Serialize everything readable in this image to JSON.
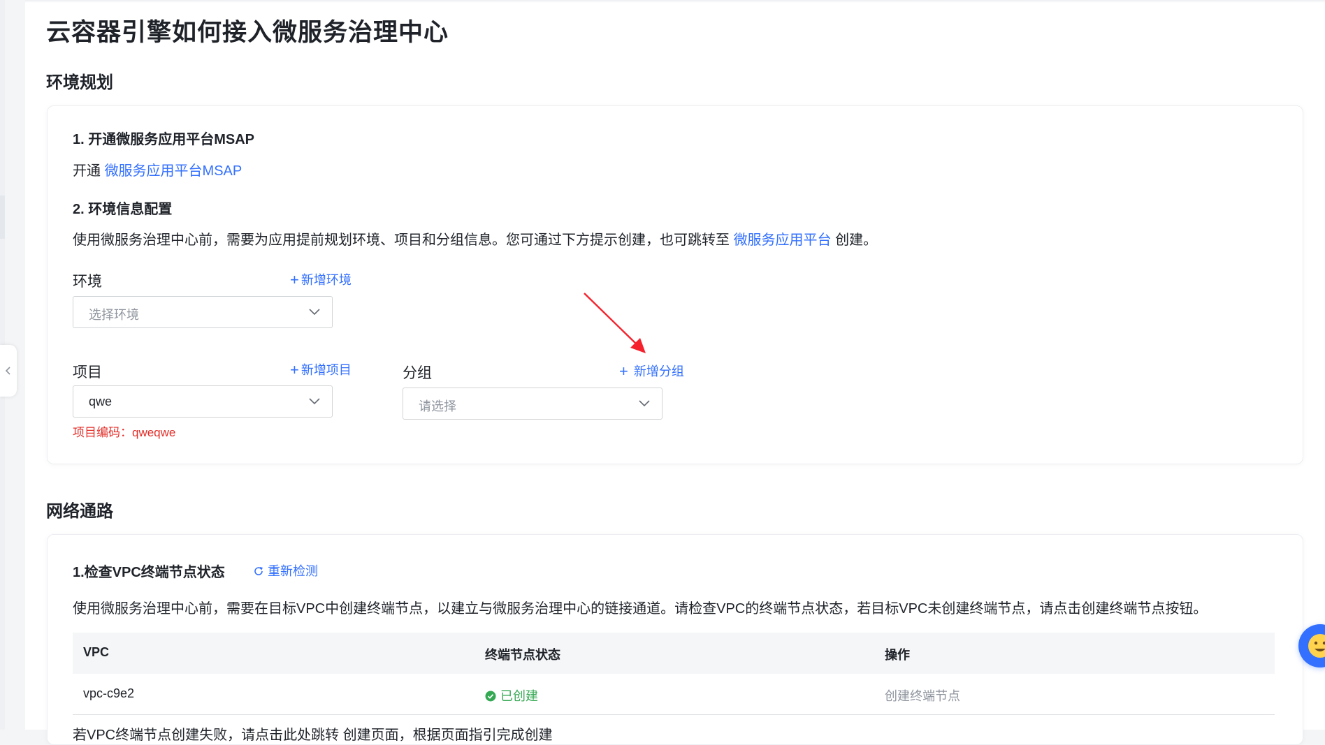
{
  "page": {
    "title": "云容器引擎如何接入微服务治理中心"
  },
  "env_section": {
    "title": "环境规划",
    "step1": {
      "title": "1. 开通微服务应用平台MSAP",
      "prefix": "开通 ",
      "link": "微服务应用平台MSAP"
    },
    "step2": {
      "title": "2. 环境信息配置",
      "desc_prefix": "使用微服务治理中心前，需要为应用提前规划环境、项目和分组信息。您可通过下方提示创建，也可跳转至 ",
      "desc_link": "微服务应用平台",
      "desc_suffix": " 创建。"
    },
    "environment": {
      "label": "环境",
      "add": "新增环境",
      "placeholder": "选择环境"
    },
    "project": {
      "label": "项目",
      "add": "新增项目",
      "value": "qwe",
      "code_text": "项目编码：qweqwe"
    },
    "group": {
      "label": "分组",
      "add": "新增分组",
      "placeholder": "请选择"
    }
  },
  "network_section": {
    "title": "网络通路",
    "step1": {
      "title": "1.检查VPC终端节点状态",
      "refresh": "重新检测",
      "desc": "使用微服务治理中心前，需要在目标VPC中创建终端节点，以建立与微服务治理中心的链接通道。请检查VPC的终端节点状态，若目标VPC未创建终端节点，请点击创建终端节点按钮。"
    },
    "table": {
      "headers": [
        "VPC",
        "终端节点状态",
        "操作"
      ],
      "rows": [
        {
          "vpc": "vpc-c9e2",
          "status": "已创建",
          "action": "创建终端节点"
        }
      ]
    },
    "bottom_text": "若VPC终端节点创建失败，请点击此处跳转 创建页面，根据页面指引完成创建"
  },
  "colors": {
    "accent": "#3370ff",
    "error": "#e22e28",
    "success": "#34a853",
    "arrow": "#f5222d"
  },
  "icons": [
    "chevron-left-icon",
    "plus-icon",
    "chevron-down-icon",
    "refresh-icon",
    "check-circle-icon",
    "smiley-icon"
  ]
}
